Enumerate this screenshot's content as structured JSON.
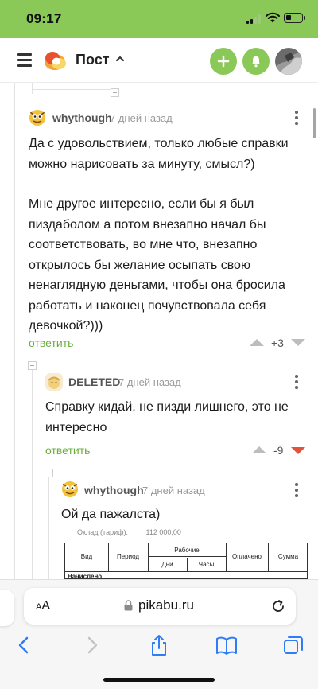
{
  "status_bar": {
    "time": "09:17",
    "icons": [
      "signal-icon",
      "wifi-icon",
      "battery-icon"
    ]
  },
  "header": {
    "title": "Пост",
    "icons": [
      "menu-icon",
      "pikabu-logo",
      "chevron-up-icon",
      "plus-icon",
      "bell-icon",
      "user-avatar"
    ]
  },
  "comments": [
    {
      "author": "whythough",
      "time": "7 дней назад",
      "paragraphs": [
        "Да с удовольствием, только любые справки можно нарисовать за минуту, смысл?)",
        "Мне другое интересно, если бы я был пиздаболом а потом внезапно начал бы соответствовать, во мне что, внезапно открылось бы желание осыпать свою ненаглядную деньгами, чтобы она бросила работать и наконец почувствовала себя девочкой?)))"
      ],
      "reply_label": "ответить",
      "rating": "+3"
    },
    {
      "author": "DELETED",
      "time": "7 дней назад",
      "paragraphs": [
        "Справку кидай, не пизди лишнего, это не интересно"
      ],
      "reply_label": "ответить",
      "rating": "-9"
    },
    {
      "author": "whythough",
      "time": "7 дней назад",
      "paragraphs": [
        "Ой да пажалста)"
      ]
    }
  ],
  "document": {
    "top_left": "Оклад (тариф):",
    "top_right": "112 000,00",
    "headers": [
      "Вид",
      "Период",
      "Рабочие",
      "Оплачено",
      "Сумма"
    ],
    "subheaders": [
      "Дни",
      "Часы"
    ],
    "row_label": "Начислено"
  },
  "browser": {
    "aa_label_small": "A",
    "aa_label": "A",
    "url": "pikabu.ru",
    "icons": [
      "lock-icon",
      "reload-icon",
      "back-icon",
      "forward-icon",
      "share-icon",
      "bookmarks-icon",
      "tabs-icon"
    ]
  },
  "colors": {
    "brand_green": "#8ac858",
    "reply_green": "#6aae3f",
    "downvote_red": "#e0533d"
  }
}
